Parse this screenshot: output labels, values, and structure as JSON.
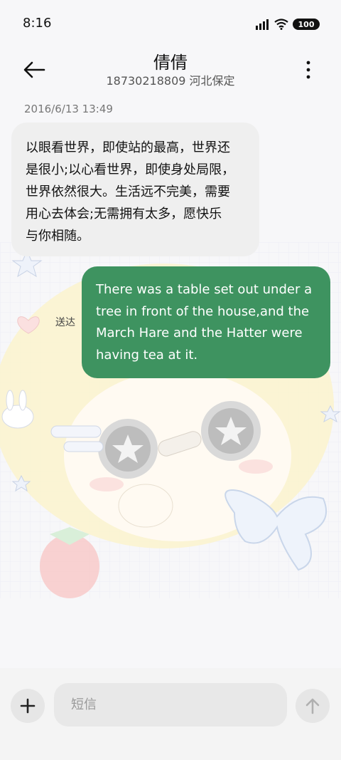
{
  "status_bar": {
    "time": "8:16",
    "battery_level": "100",
    "icons": [
      "signal-icon",
      "wifi-icon",
      "battery-icon"
    ]
  },
  "header": {
    "title": "倩倩",
    "subtitle": "18730218809 河北保定",
    "back_icon": "back-arrow-icon",
    "more_icon": "more-vertical-icon"
  },
  "conversation": {
    "timestamp": "2016/6/13 13:49",
    "messages": [
      {
        "direction": "incoming",
        "lines": [
          "以眼看世界，即使站的最高，世界还",
          "是很小;以心看世界，即使身处局限，",
          "世界依然很大。生活远不完美，需要",
          "用心去体会;无需拥有太多，愿快乐",
          "与你相随。"
        ]
      },
      {
        "direction": "outgoing",
        "lines": [
          "There was a table set out under a",
          "tree in front of the house,and the",
          "March Hare and the Hatter were",
          "having tea at it."
        ],
        "status": "送达"
      }
    ]
  },
  "composer": {
    "placeholder": "短信",
    "value": "",
    "add_icon": "plus-icon",
    "send_icon": "send-arrow-icon"
  },
  "colors": {
    "outgoing_bubble": "#3e9360",
    "incoming_bubble": "#efefef",
    "background": "#f7f7f9"
  },
  "background_art": "anime-girl-wallpaper"
}
